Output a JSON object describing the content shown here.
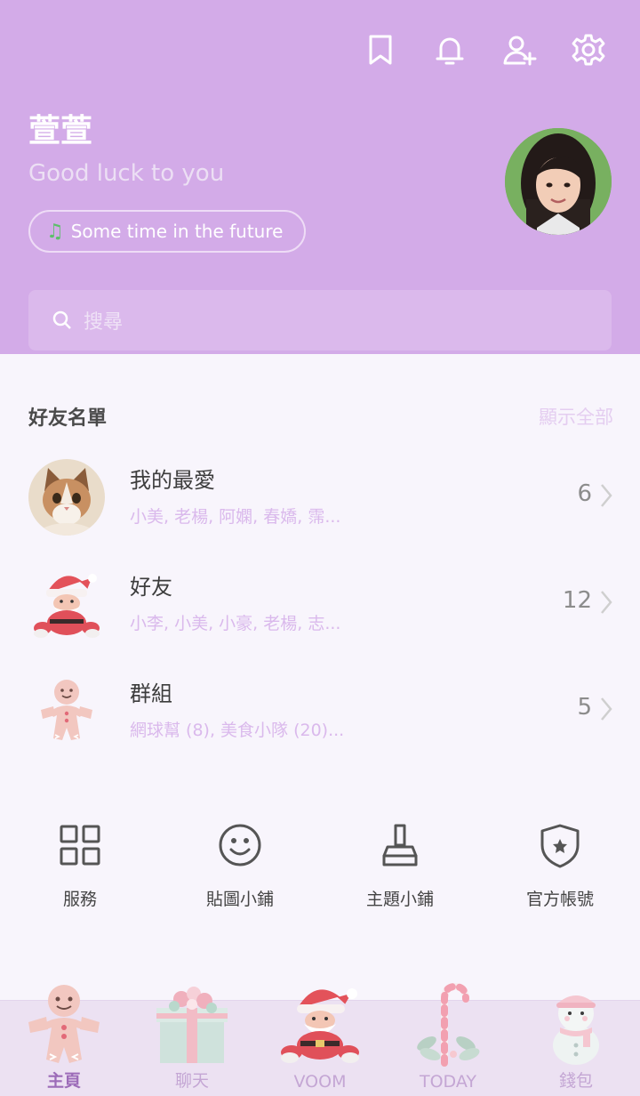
{
  "header": {
    "icons": [
      "bookmark-icon",
      "bell-icon",
      "add-friend-icon",
      "gear-icon"
    ],
    "profile_name": "萱萱",
    "status_message": "Good luck to you",
    "music": "Some time in the future"
  },
  "search": {
    "placeholder": "搜尋"
  },
  "friends": {
    "title": "好友名單",
    "show_all": "顯示全部",
    "rows": [
      {
        "title": "我的最愛",
        "subtitle": "小美, 老楊, 阿嫻, 春嬌, 霈...",
        "count": "6"
      },
      {
        "title": "好友",
        "subtitle": "小李, 小美, 小豪, 老楊, 志...",
        "count": "12"
      },
      {
        "title": "群組",
        "subtitle": "網球幫 (8), 美食小隊 (20)...",
        "count": "5"
      }
    ]
  },
  "services": [
    {
      "label": "服務",
      "icon": "grid-icon"
    },
    {
      "label": "貼圖小鋪",
      "icon": "smiley-icon"
    },
    {
      "label": "主題小鋪",
      "icon": "brush-icon"
    },
    {
      "label": "官方帳號",
      "icon": "shield-star-icon"
    }
  ],
  "tabbar": {
    "tabs": [
      {
        "label": "主頁",
        "icon": "gingerbread-icon",
        "active": true
      },
      {
        "label": "聊天",
        "icon": "gift-icon",
        "active": false
      },
      {
        "label": "VOOM",
        "icon": "santa-icon",
        "active": false
      },
      {
        "label": "TODAY",
        "icon": "candy-cane-icon",
        "active": false
      },
      {
        "label": "錢包",
        "icon": "snowman-icon",
        "active": false
      }
    ]
  },
  "colors": {
    "header_bg": "#d3abe8",
    "accent": "#dab9ec",
    "tab_active": "#9c6bb8"
  }
}
